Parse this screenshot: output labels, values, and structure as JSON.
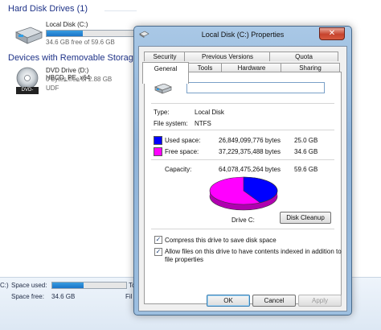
{
  "explorer": {
    "hard_disk_header": "Hard Disk Drives (1)",
    "local_disk": {
      "name": "Local Disk (C:)",
      "free_text": "34.6 GB free of 59.6 GB",
      "used_fraction": 0.42
    },
    "removable_header": "Devices with Removable Storage",
    "dvd_drive": {
      "name": "DVD Drive (D:) HBCD_PE_x64",
      "free_text": "0 bytes free of 2.88 GB",
      "filesystem": "UDF",
      "badge": "DVD-ROM"
    },
    "status": {
      "drive_label": "C:)",
      "space_used_label": "Space used:",
      "space_free_label": "Space free:",
      "space_free_value": "34.6 GB",
      "col2_top": "Tc",
      "col2_bottom": "Fil",
      "used_fraction": 0.42
    }
  },
  "dialog": {
    "title": "Local Disk (C:) Properties",
    "close_glyph": "✕",
    "tabs_row1": [
      {
        "label": "Security"
      },
      {
        "label": "Previous Versions"
      },
      {
        "label": "Quota"
      }
    ],
    "tabs_row2": [
      {
        "label": "General"
      },
      {
        "label": "Tools"
      },
      {
        "label": "Hardware"
      },
      {
        "label": "Sharing"
      }
    ],
    "general": {
      "name_value": "",
      "type_label": "Type:",
      "type_value": "Local Disk",
      "fs_label": "File system:",
      "fs_value": "NTFS",
      "used_label": "Used space:",
      "used_bytes": "26,849,099,776 bytes",
      "used_gb": "25.0 GB",
      "free_label": "Free space:",
      "free_bytes": "37,229,375,488 bytes",
      "free_gb": "34.6 GB",
      "capacity_label": "Capacity:",
      "capacity_bytes": "64,078,475,264 bytes",
      "capacity_gb": "59.6 GB",
      "drive_label": "Drive C:",
      "disk_cleanup": "Disk Cleanup",
      "compress_label": "Compress this drive to save disk space",
      "compress_checked": true,
      "index_label_1": "Allow files on this drive to have contents indexed in addition to",
      "index_label_2": "file properties",
      "index_checked": true,
      "used_fraction": 0.419,
      "used_color": "#0000ff",
      "free_color": "#ff00ff"
    },
    "buttons": {
      "ok": "OK",
      "cancel": "Cancel",
      "apply": "Apply"
    }
  }
}
